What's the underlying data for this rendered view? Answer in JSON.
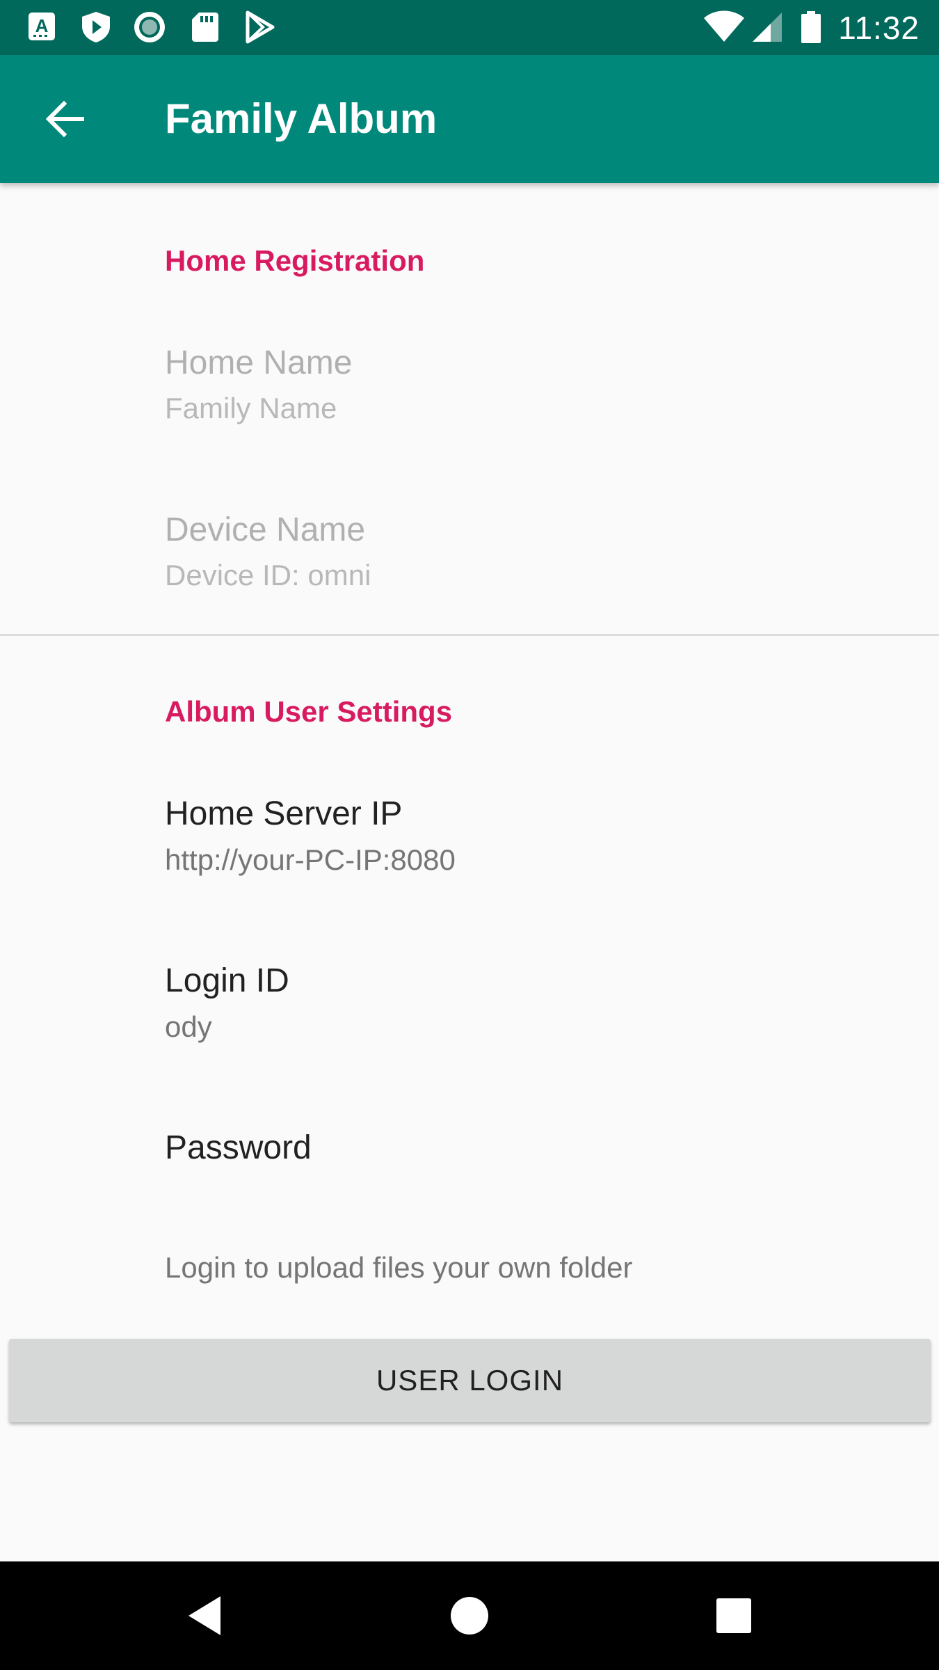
{
  "status_bar": {
    "time": "11:32",
    "left_icons": [
      "a-keyboard-icon",
      "shield-play-icon",
      "circle-record-icon",
      "sd-card-icon",
      "play-store-icon"
    ],
    "right_icons": [
      "wifi-icon",
      "cellular-signal-icon",
      "battery-icon"
    ]
  },
  "app_bar": {
    "title": "Family Album",
    "back_icon": "arrow-back-icon",
    "color": "#00897b"
  },
  "sections": {
    "home_registration": {
      "header": "Home Registration",
      "items": [
        {
          "title": "Home Name",
          "summary": "Family Name",
          "enabled": false
        },
        {
          "title": "Device Name",
          "summary": "Device ID: omni",
          "enabled": false
        }
      ]
    },
    "album_user_settings": {
      "header": "Album User Settings",
      "items": [
        {
          "title": "Home Server IP",
          "summary": "http://your-PC-IP:8080"
        },
        {
          "title": "Login ID",
          "summary": "ody"
        },
        {
          "title": "Password",
          "summary": ""
        }
      ]
    }
  },
  "hint": "Login to upload files your own folder",
  "login_button": {
    "label": "USER LOGIN"
  },
  "nav_bar": {
    "icons": [
      "back-triangle-icon",
      "home-circle-icon",
      "recents-square-icon"
    ]
  },
  "colors": {
    "status_bar": "#00695c",
    "accent": "#d81b60",
    "button_bg": "#d6d7d7"
  }
}
